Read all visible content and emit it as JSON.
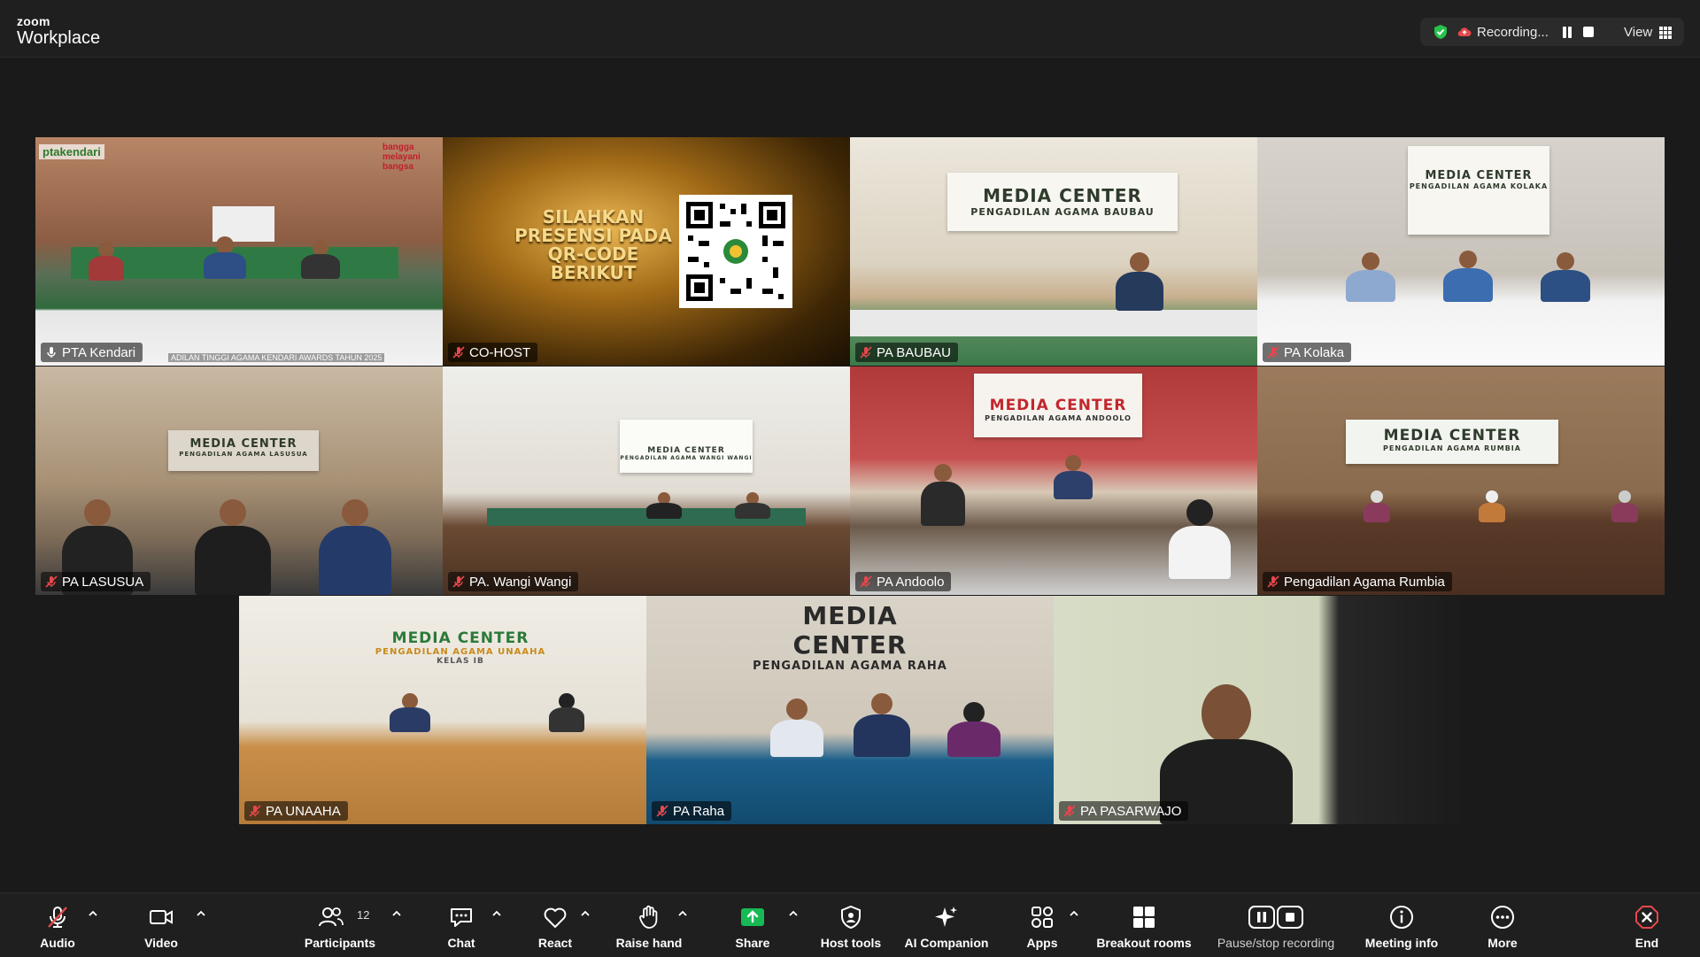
{
  "app": {
    "brand_top": "zoom",
    "brand_bottom": "Workplace"
  },
  "recording": {
    "status": "Recording...",
    "view_label": "View",
    "colors": {
      "shield": "#27c24c",
      "cloud": "#e5484d"
    }
  },
  "tiles": [
    {
      "name": "PTA Kendari",
      "mic": "mic-on",
      "active": true,
      "overlay_logo": "ptakendari",
      "overlay_tag": "bangga melayani bangsa",
      "banner_text": "ADILAN TINGGI AGAMA KENDARI AWARDS TAHUN 2025"
    },
    {
      "name": "CO-HOST",
      "mic": "muted",
      "slide_text": "SILAHKAN PRESENSI PADA QR-CODE BERIKUT"
    },
    {
      "name": "PA BAUBAU",
      "mic": "muted",
      "banner_title": "MEDIA CENTER",
      "banner_sub": "PENGADILAN AGAMA BAUBAU"
    },
    {
      "name": "PA Kolaka",
      "mic": "muted",
      "banner_title": "MEDIA CENTER",
      "banner_sub": "PENGADILAN AGAMA KOLAKA"
    },
    {
      "name": "PA LASUSUA",
      "mic": "muted",
      "banner_title": "MEDIA CENTER",
      "banner_sub": "PENGADILAN AGAMA LASUSUA"
    },
    {
      "name": "PA. Wangi Wangi",
      "mic": "muted",
      "banner_title": "MEDIA CENTER",
      "banner_sub": "PENGADILAN AGAMA WANGI WANGI"
    },
    {
      "name": "PA Andoolo",
      "mic": "muted",
      "banner_title": "MEDIA CENTER",
      "banner_sub": "PENGADILAN AGAMA ANDOOLO"
    },
    {
      "name": "Pengadilan Agama Rumbia",
      "mic": "muted",
      "banner_title": "MEDIA CENTER",
      "banner_sub": "PENGADILAN AGAMA RUMBIA"
    },
    {
      "name": "PA UNAAHA",
      "mic": "muted",
      "banner_title": "MEDIA CENTER",
      "banner_sub": "PENGADILAN AGAMA UNAAHA",
      "banner_sub2": "KELAS IB"
    },
    {
      "name": "PA Raha",
      "mic": "muted",
      "banner_title": "MEDIA CENTER",
      "banner_sub": "PENGADILAN AGAMA RAHA"
    },
    {
      "name": "PA PASARWAJO",
      "mic": "muted"
    }
  ],
  "toolbar": {
    "audio": "Audio",
    "video": "Video",
    "participants": "Participants",
    "participants_count": "12",
    "chat": "Chat",
    "react": "React",
    "raise_hand": "Raise hand",
    "share": "Share",
    "host_tools": "Host tools",
    "ai_companion": "AI Companion",
    "apps": "Apps",
    "breakout_rooms": "Breakout rooms",
    "pause_stop_recording": "Pause/stop recording",
    "meeting_info": "Meeting info",
    "more": "More",
    "end": "End",
    "colors": {
      "share": "#17b955",
      "muted": "#e5484d",
      "end": "#e5484d"
    }
  }
}
